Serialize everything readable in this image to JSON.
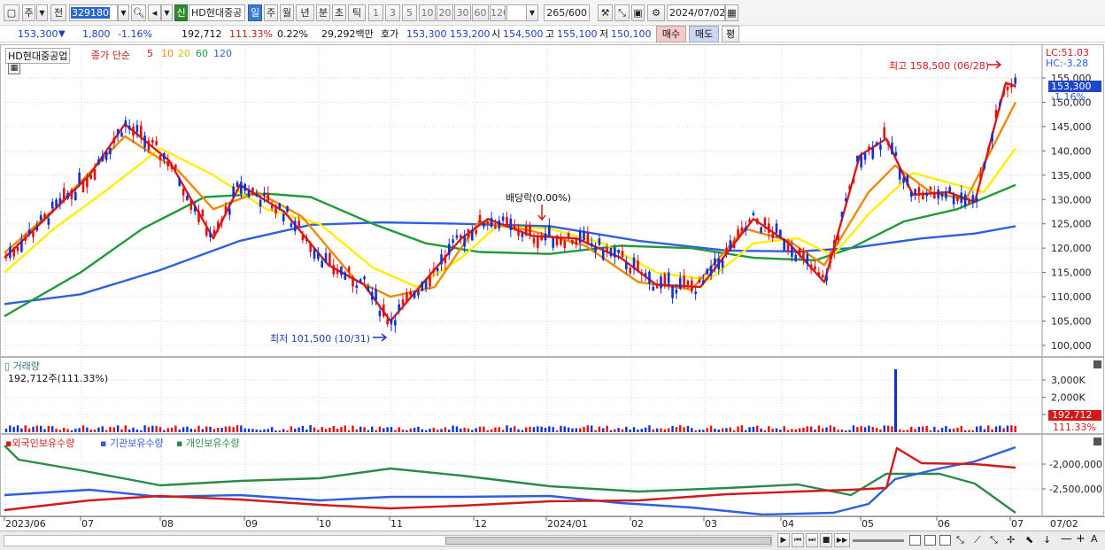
{
  "toolbar": {
    "market_type": "주",
    "prev_label": "전",
    "stock_code": "329180",
    "sin_label": "신",
    "stock_name": "HD현대중공",
    "periods": [
      "일",
      "주",
      "월",
      "년",
      "분",
      "초",
      "틱"
    ],
    "selected_period": "일",
    "intervals": [
      "1",
      "3",
      "5",
      "10",
      "20",
      "30",
      "60",
      "120"
    ],
    "count": "265",
    "count_total": "/600",
    "date": "2024/07/02"
  },
  "quote": {
    "price": "153,300",
    "down_arrow": "▼",
    "change": "1,800",
    "change_pct": "-1.16%",
    "volume": "192,712",
    "volume_ratio": "111.33%",
    "turnover": "0.22%",
    "amount": "29,292백만",
    "ask_label": "호가",
    "ask1": "153,300",
    "ask2": "153,200",
    "open_label": "시",
    "open": "154,500",
    "high_label": "고",
    "high": "155,100",
    "low_label": "저",
    "low": "150,100",
    "buy_label": "매수",
    "sell_label": "매도",
    "eval_label": "평"
  },
  "price_panel": {
    "legend_name": "HD현대중공업",
    "legend_price": "종가 단순",
    "ma_periods": [
      "5",
      "10",
      "20",
      "60",
      "120"
    ],
    "ma_colors": [
      "#d91a1a",
      "#f08a00",
      "#ffee00",
      "#1f9a3a",
      "#2e5fe0"
    ],
    "lc_label": "LC:51.03",
    "hc_label": "HC:-3.28",
    "high_annot": "최고 158,500 (06/28)",
    "low_annot": "최저 101,500 (10/31)",
    "dividend_annot": "배당락(0.00%)",
    "current_price_tag": "153,300",
    "current_pct_tag": "-1.16%",
    "y_ticks": [
      "155,000",
      "150,000",
      "145,000",
      "140,000",
      "135,000",
      "130,000",
      "125,000",
      "120,000",
      "115,000",
      "110,000",
      "105,000",
      "100,000"
    ]
  },
  "volume_panel": {
    "title": "거래량",
    "value_text": "192,712주(111.33%)",
    "y_ticks": [
      "3,000K",
      "2,000K",
      "1,000K"
    ],
    "current_tag": "192,712",
    "current_pct": "111.33%"
  },
  "holdings_panel": {
    "legends": [
      "외국인보유수량",
      "기관보유수량",
      "개인보유수량"
    ],
    "legend_colors": [
      "#d21a1a",
      "#2e5fe0",
      "#2a8a4a"
    ],
    "y_ticks": [
      "-2,000,000",
      "-2,500,000"
    ]
  },
  "x_axis": {
    "labels": [
      "2023/06",
      "07",
      "08",
      "09",
      "10",
      "11",
      "12",
      "2024/01",
      "02",
      "03",
      "04",
      "05",
      "06",
      "07"
    ],
    "right_date": "07/02"
  },
  "bottom_controls": {
    "symbols": [
      "▶",
      "⏮",
      "⏭",
      "■",
      "▶▶",
      "—",
      "+",
      "A"
    ]
  }
}
